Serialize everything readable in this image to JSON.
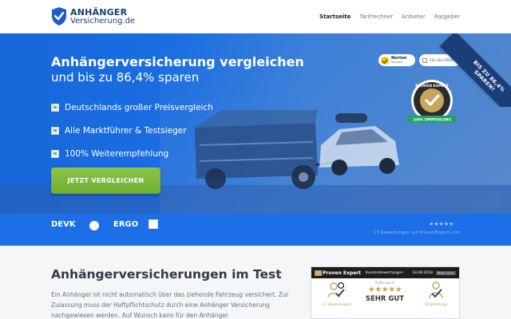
{
  "header": {
    "logo_top": "ANHÄNGER",
    "logo_bottom": "Versicherung.de",
    "nav": [
      {
        "label": "Startseite",
        "active": true
      },
      {
        "label": "Tarifrechner",
        "active": false
      },
      {
        "label": "Anbieter",
        "active": false
      },
      {
        "label": "Ratgeber",
        "active": false
      }
    ]
  },
  "hero": {
    "title": "Anhängerversicherung vergleichen",
    "subtitle": "und bis zu 86,4% sparen",
    "bullets": [
      "Deutschlands großer Preisvergleich",
      "Alle Marktführer & Testsieger",
      "100% Weiterempfehlung"
    ],
    "cta": "JETZT VERGLEICHEN",
    "ribbon_line1": "BIS ZU 86,4%",
    "ribbon_line2": "SPAREN!",
    "norton": {
      "name": "Norton",
      "sub": "SECURED"
    },
    "ssl": "SSL SECURED",
    "badge": {
      "line1": "PROVEN EXPERT",
      "line2": "100% EMPFEHLUNG"
    }
  },
  "strip": {
    "insurers": [
      "DEVK",
      "ERGO"
    ],
    "stars": "★★★★★",
    "reviews": "13 Bewertungen auf ProvenExpert.com"
  },
  "content": {
    "heading": "Anhängerversicherungen im Test",
    "paragraph": "Ein Anhänger ist nicht automatisch über das ziehende Fahrzeug versichert. Zur Zulassung muss der Haftpflichtschutz durch eine Anhänger Versicherung nachgewiesen werden. Auf Wunsch kann für den Anhänger"
  },
  "widget": {
    "brand": "Proven Expert",
    "title": "Kundenbewertungen",
    "date": "18.08.2018",
    "tag": "Mehr Infos",
    "reviews": "13 Bewertungen",
    "score": "5,00 von 5",
    "stars": "★★★★★",
    "grade": "SEHR GUT",
    "recommend": "Empfehlung"
  },
  "colors": {
    "primary": "#1c6fe6",
    "cta": "#7cbb3a",
    "ribbon": "#1a3e78",
    "gold": "#c9a45c"
  }
}
